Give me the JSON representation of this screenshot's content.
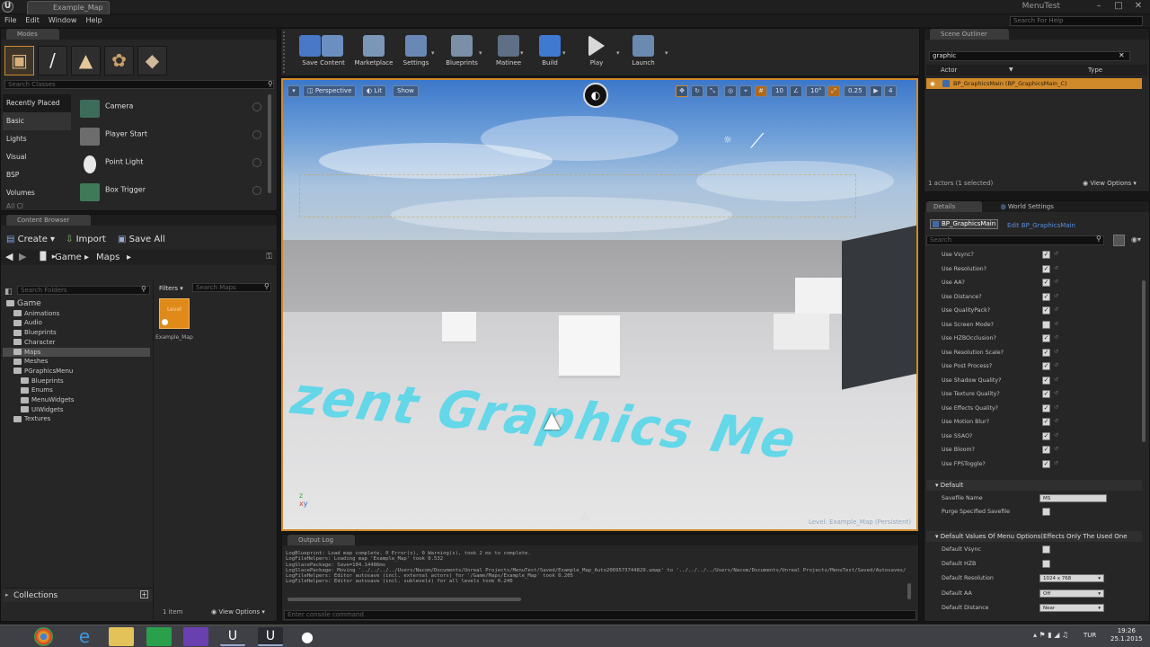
{
  "window": {
    "tab_title": "Example_Map",
    "app_title": "MenuTest",
    "logo": "U",
    "help_search_placeholder": "Search For Help",
    "menu": [
      "File",
      "Edit",
      "Window",
      "Help"
    ]
  },
  "modes": {
    "title": "Modes",
    "search_placeholder": "Search Classes",
    "categories": [
      "Recently Placed",
      "Basic",
      "Lights",
      "Visual",
      "BSP",
      "Volumes",
      "All Cl"
    ],
    "items": [
      {
        "label": "Camera",
        "icon": "camera-icon"
      },
      {
        "label": "Player Start",
        "icon": "player-start-icon"
      },
      {
        "label": "Point Light",
        "icon": "point-light-icon"
      },
      {
        "label": "Box Trigger",
        "icon": "box-trigger-icon"
      }
    ]
  },
  "content_browser": {
    "title": "Content Browser",
    "create_label": "Create",
    "import_label": "Import",
    "save_all_label": "Save All",
    "path": [
      "Game",
      "Maps"
    ],
    "folder_search_placeholder": "Search Folders",
    "filters_label": "Filters",
    "asset_search_placeholder": "Search Maps",
    "tree": [
      {
        "label": "Game",
        "depth": 0
      },
      {
        "label": "Animations",
        "depth": 1
      },
      {
        "label": "Audio",
        "depth": 1
      },
      {
        "label": "Blueprints",
        "depth": 1
      },
      {
        "label": "Character",
        "depth": 1
      },
      {
        "label": "Maps",
        "depth": 1,
        "selected": true
      },
      {
        "label": "Meshes",
        "depth": 1
      },
      {
        "label": "PGraphicsMenu",
        "depth": 1
      },
      {
        "label": "Blueprints",
        "depth": 2
      },
      {
        "label": "Enums",
        "depth": 2
      },
      {
        "label": "MenuWidgets",
        "depth": 2
      },
      {
        "label": "UIWidgets",
        "depth": 2
      },
      {
        "label": "Textures",
        "depth": 1
      }
    ],
    "asset": {
      "thumb_text": "Level",
      "name": "Example_Map"
    },
    "collections_label": "Collections",
    "item_count": "1 item",
    "view_options": "View Options"
  },
  "toolbar": {
    "buttons": [
      "Save",
      "Content",
      "Marketplace",
      "Settings",
      "Blueprints",
      "Matinee",
      "Build",
      "Play",
      "Launch"
    ]
  },
  "viewport": {
    "perspective_label": "Perspective",
    "lit_label": "Lit",
    "show_label": "Show",
    "snap_values": [
      "10",
      "10°",
      "0.25",
      "4"
    ],
    "floor_text": "zent Graphics Me",
    "level_name": "Level: Example_Map (Persistent)"
  },
  "output_log": {
    "title": "Output Log",
    "lines": [
      "LogBlueprint: Load map complete. 0 Error(s), 0 Warning(s), took 2 ms to complete.",
      "LogFileHelpers: Loading map 'Example_Map' took 0.532",
      "LogSlacePackage: Save=104.14486ms",
      "LogSlacePackage: Moving '../../../../Users/Nacom/Documents/Unreal Projects/MenuTest/Saved/Example_Map_Auto2069573744829.umap' to '../../../../Users/Nacom/Documents/Unreal Projects/MenuTest/Saved/Autosaves/Game/Maps/Example_Map.umap'",
      "LogFileHelpers: Editor autosave (incl. external actors) for '/Game/Maps/Example_Map' took 0.205",
      "LogFileHelpers: Editor autosave (incl. sublevels) for all levels took 0.240"
    ],
    "console_placeholder": "Enter console command"
  },
  "outliner": {
    "title": "Scene Outliner",
    "search_value": "graphic",
    "col_actor": "Actor",
    "col_type": "Type",
    "row_label": "BP_GraphicsMain (BP_GraphicsMain_C)",
    "actor_count": "1 actors (1 selected)",
    "view_options": "View Options"
  },
  "details": {
    "tab_details": "Details",
    "tab_world": "World Settings",
    "object_name": "BP_GraphicsMain",
    "edit_link": "Edit BP_GraphicsMain",
    "search_placeholder": "Search",
    "bool_props": [
      {
        "label": "Use Vsync?",
        "checked": true
      },
      {
        "label": "Use Resolution?",
        "checked": true
      },
      {
        "label": "Use AA?",
        "checked": true
      },
      {
        "label": "Use Distance?",
        "checked": true
      },
      {
        "label": "Use QualityPack?",
        "checked": true
      },
      {
        "label": "Use Screen Mode?",
        "checked": false
      },
      {
        "label": "Use HZBOcclusion?",
        "checked": true
      },
      {
        "label": "Use Resolution Scale?",
        "checked": true
      },
      {
        "label": "Use Post Process?",
        "checked": true
      },
      {
        "label": "Use Shadow Quality?",
        "checked": true
      },
      {
        "label": "Use Texture Quality?",
        "checked": true
      },
      {
        "label": "Use Effects Quality?",
        "checked": true
      },
      {
        "label": "Use Motion Blur?",
        "checked": true
      },
      {
        "label": "Use SSAO?",
        "checked": true
      },
      {
        "label": "Use Bloom?",
        "checked": true
      },
      {
        "label": "Use FPSToggle?",
        "checked": true
      }
    ],
    "default_section": "Default",
    "savefile_label": "Savefile Name",
    "savefile_value": "MS",
    "purge_label": "Purge Specified Savefile",
    "defaults_section": "Default Values Of Menu Options(Effects Only The Used One",
    "default_props": [
      {
        "label": "Default Vsync",
        "kind": "check"
      },
      {
        "label": "Default HZB",
        "kind": "check"
      },
      {
        "label": "Default Resolution",
        "kind": "combo",
        "value": "1024 x 768"
      },
      {
        "label": "Default AA",
        "kind": "combo",
        "value": "Off"
      },
      {
        "label": "Default Distance",
        "kind": "combo",
        "value": "Near"
      }
    ]
  },
  "taskbar": {
    "time": "19:26",
    "date": "25.1.2015",
    "lang": "TUR"
  }
}
